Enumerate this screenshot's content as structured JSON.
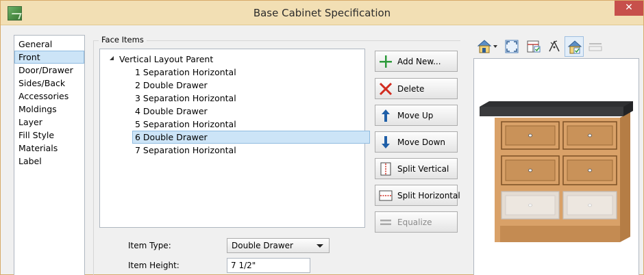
{
  "window": {
    "title": "Base Cabinet Specification",
    "close_glyph": "✕"
  },
  "sidebar": {
    "items": [
      {
        "label": "General"
      },
      {
        "label": "Front",
        "selected": true
      },
      {
        "label": "Door/Drawer"
      },
      {
        "label": "Sides/Back"
      },
      {
        "label": "Accessories"
      },
      {
        "label": "Moldings"
      },
      {
        "label": "Layer"
      },
      {
        "label": "Fill Style"
      },
      {
        "label": "Materials"
      },
      {
        "label": "Label"
      }
    ]
  },
  "face_items": {
    "group_label": "Face Items",
    "parent": "Vertical Layout Parent",
    "items": [
      {
        "label": "1 Separation Horizontal"
      },
      {
        "label": "2 Double Drawer"
      },
      {
        "label": "3 Separation Horizontal"
      },
      {
        "label": "4 Double Drawer"
      },
      {
        "label": "5 Separation Horizontal"
      },
      {
        "label": "6 Double Drawer",
        "selected": true
      },
      {
        "label": "7 Separation Horizontal"
      }
    ]
  },
  "actions": {
    "add_new": "Add New...",
    "delete": "Delete",
    "move_up": "Move Up",
    "move_down": "Move Down",
    "split_vertical": "Split Vertical",
    "split_horizontal": "Split Horizontal",
    "equalize": "Equalize"
  },
  "item_type": {
    "label": "Item Type:",
    "value": "Double Drawer"
  },
  "item_height": {
    "label": "Item Height:",
    "value": "7 1/2\""
  },
  "preview": {
    "toolbar_icons": [
      "camera-view-icon",
      "fit-view-icon",
      "cabinet-view-icon",
      "cursor-move-icon",
      "elevation-view-icon",
      "restore-icon"
    ]
  },
  "colors": {
    "title_bar": "#f2dfb4",
    "selection": "#cce4f7",
    "close_button": "#c7504b",
    "cabinet_wood": "#d9a168",
    "countertop": "#3a3b3d"
  }
}
